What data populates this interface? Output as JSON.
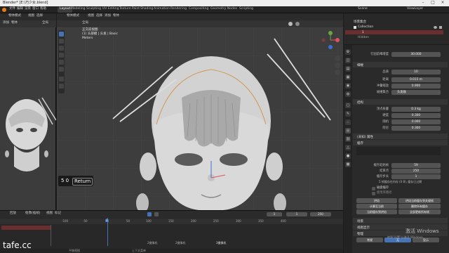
{
  "title_bar": {
    "text": "Blender* [E:\\巧少女.blend]"
  },
  "menu": {
    "items": [
      "文件",
      "编辑",
      "渲染",
      "窗口",
      "帮助"
    ]
  },
  "workspaces": {
    "tabs": [
      "Layout",
      "Modeling",
      "Sculpting",
      "UV Editing",
      "Texture Paint",
      "Shading",
      "Animation",
      "Rendering",
      "Compositing",
      "Geometry Nodes",
      "Scripting"
    ],
    "active": "Layout"
  },
  "top_right": {
    "scene": "Scene",
    "view_layer": "ViewLayer"
  },
  "left_viewport": {
    "mode": "物体模式",
    "view": "视图",
    "select": "选择",
    "add": "添加",
    "object": "物体",
    "global": "全局"
  },
  "main_viewport": {
    "mode": "物体模式",
    "view": "视图",
    "select": "选择",
    "add": "添加",
    "object": "物体",
    "global": "全局",
    "overlay_title": "正交前视图",
    "overlay_obj": "(1) 头部模 | 头发 | Basic",
    "overlay_units": "Meters"
  },
  "return_hint": {
    "keys": "5 0",
    "label": "Return"
  },
  "outliner": {
    "title": "场景集合",
    "rows": [
      "Collection",
      "1",
      "Hidden"
    ]
  },
  "properties": {
    "header_value": "30.000",
    "header_label": "钉固前细增度",
    "sections": [
      {
        "title": "细缠",
        "fields": [
          {
            "label": "品质",
            "value": "10"
          },
          {
            "label": "距离",
            "value": "0.015 m"
          },
          {
            "label": "冲量缩放",
            "value": "0.900"
          },
          {
            "label": "碰撞集合",
            "value": "头发碰"
          }
        ]
      },
      {
        "title": "结构",
        "fields": [
          {
            "label": "顶点质量",
            "value": "0.3 kg"
          },
          {
            "label": "硬度",
            "value": "0.300"
          },
          {
            "label": "随机",
            "value": "0.000"
          },
          {
            "label": "阻尼",
            "value": "0.300"
          }
        ]
      }
    ],
    "shape_title": "(未知) 属性",
    "shape_sub": "缓存",
    "cache": {
      "start_label": "缓存起始帧",
      "start": "59",
      "end_label": "结束点",
      "end": "250",
      "step_label": "缓存步长",
      "step": "1"
    },
    "disk_cache": "磁盘缓存",
    "use_lib_path": "使用库路径",
    "info": "5 帧缓存在内存 (0 B), 缓存已过期",
    "bake_buttons": [
      "烘焙",
      "烘焙当前缓存到关键帧",
      "计算至当前",
      "删除所有缓存",
      "当前缓存到烘焙",
      "全部更新所有帧"
    ],
    "bottom_sections": [
      "场景",
      "视图显示",
      "物理"
    ],
    "bottom_tabs": [
      "常规",
      "无",
      "显示"
    ]
  },
  "timeline": {
    "menus": [
      "回放",
      "抠像(插帧)",
      "视图",
      "标记"
    ],
    "frame_ticks": [
      "-100",
      "-50",
      "0",
      "50",
      "100",
      "150",
      "200",
      "250",
      "300",
      "350",
      "400"
    ],
    "current_frame": "1",
    "start": "1",
    "end": "250",
    "markers": [
      "2摄像机",
      "2摄像机",
      "3摄像机"
    ],
    "status_left": "平移视图",
    "status_mid": "上下文菜单"
  },
  "watermark": {
    "text": "tafe.cc"
  },
  "activation": {
    "line1": "激活 Windows",
    "line2": "转到\"设置\"以激活 Windows。"
  },
  "colors": {
    "accent": "#4772b3",
    "header": "#2b2b2b",
    "viewport_bg": "#3d3d3d",
    "playhead": "#4772b3"
  }
}
